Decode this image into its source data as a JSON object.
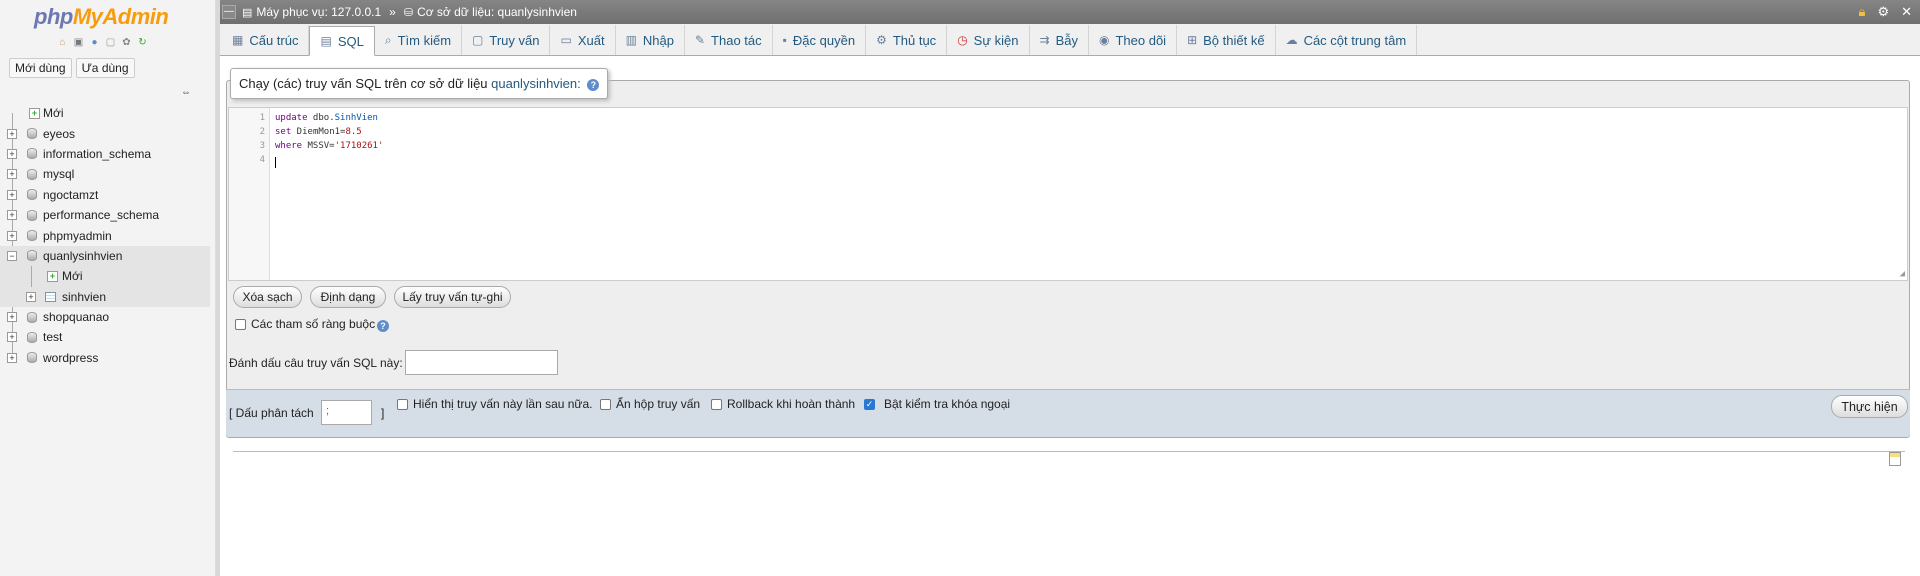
{
  "nav": {
    "logo_php": "php",
    "logo_mya": "MyAdmin",
    "icons": [
      "home-icon",
      "logout-icon",
      "help-icon",
      "docs-icon",
      "settings-icon",
      "reload-icon"
    ],
    "tabs": [
      "Mới dùng",
      "Ưa dùng"
    ],
    "tree": [
      {
        "label": "Mới",
        "type": "new"
      },
      {
        "label": "eyeos",
        "type": "db"
      },
      {
        "label": "information_schema",
        "type": "db"
      },
      {
        "label": "mysql",
        "type": "db"
      },
      {
        "label": "ngoctamzt",
        "type": "db"
      },
      {
        "label": "performance_schema",
        "type": "db"
      },
      {
        "label": "phpmyadmin",
        "type": "db"
      },
      {
        "label": "quanlysinhvien",
        "type": "db",
        "expanded": true
      },
      {
        "label": "Mới",
        "type": "child-new"
      },
      {
        "label": "sinhvien",
        "type": "table"
      },
      {
        "label": "shopquanao",
        "type": "db"
      },
      {
        "label": "test",
        "type": "db"
      },
      {
        "label": "wordpress",
        "type": "db"
      }
    ]
  },
  "topbar": {
    "server": "Máy phục vụ: 127.0.0.1",
    "separator": "»",
    "database": "Cơ sở dữ liệu: quanlysinhvien"
  },
  "tabs": [
    {
      "label": "Cấu trúc",
      "icon": "structure-icon"
    },
    {
      "label": "SQL",
      "icon": "sql-icon",
      "active": true
    },
    {
      "label": "Tìm kiếm",
      "icon": "search-icon"
    },
    {
      "label": "Truy vấn",
      "icon": "query-icon"
    },
    {
      "label": "Xuất",
      "icon": "export-icon"
    },
    {
      "label": "Nhập",
      "icon": "import-icon"
    },
    {
      "label": "Thao tác",
      "icon": "operations-icon"
    },
    {
      "label": "Đặc quyền",
      "icon": "privileges-icon"
    },
    {
      "label": "Thủ tục",
      "icon": "routines-icon"
    },
    {
      "label": "Sự kiện",
      "icon": "events-icon"
    },
    {
      "label": "Bẫy",
      "icon": "triggers-icon"
    },
    {
      "label": "Theo dõi",
      "icon": "tracking-icon"
    },
    {
      "label": "Bộ thiết kế",
      "icon": "designer-icon"
    },
    {
      "label": "Các cột trung tâm",
      "icon": "central-columns-icon"
    }
  ],
  "sql": {
    "legend_prefix": "Chạy (các) truy vấn SQL trên cơ sở dữ liệu ",
    "legend_db": "quanlysinhvien:",
    "line_numbers": [
      "1",
      "2",
      "3",
      "4"
    ],
    "lines": {
      "l1_kw": "update",
      "l1_rest": " dbo.",
      "l1_var": "SinhVien",
      "l2_kw": "set",
      "l2_rest": " DiemMon1=",
      "l2_num": "8.5",
      "l3_kw": "where",
      "l3_rest": " MSSV=",
      "l3_str": "'1710261'"
    },
    "buttons": {
      "clear": "Xóa sạch",
      "format": "Định dạng",
      "autosave": "Lấy truy vấn tự-ghi"
    },
    "bind_params_label": "Các tham số ràng buộc",
    "bookmark_label": "Đánh dấu câu truy vấn SQL này:",
    "bookmark_value": "",
    "delimiter_open": "[ Dấu phân tách",
    "delimiter_value": ";",
    "delimiter_close": "]",
    "options": [
      {
        "label": "Hiển thị truy vấn này lần sau nữa.",
        "checked": false
      },
      {
        "label": "Ẩn hộp truy vấn",
        "checked": false
      },
      {
        "label": "Rollback khi hoàn thành",
        "checked": false
      },
      {
        "label": "Bật kiểm tra khóa ngoại",
        "checked": true
      }
    ],
    "execute": "Thực hiện"
  }
}
